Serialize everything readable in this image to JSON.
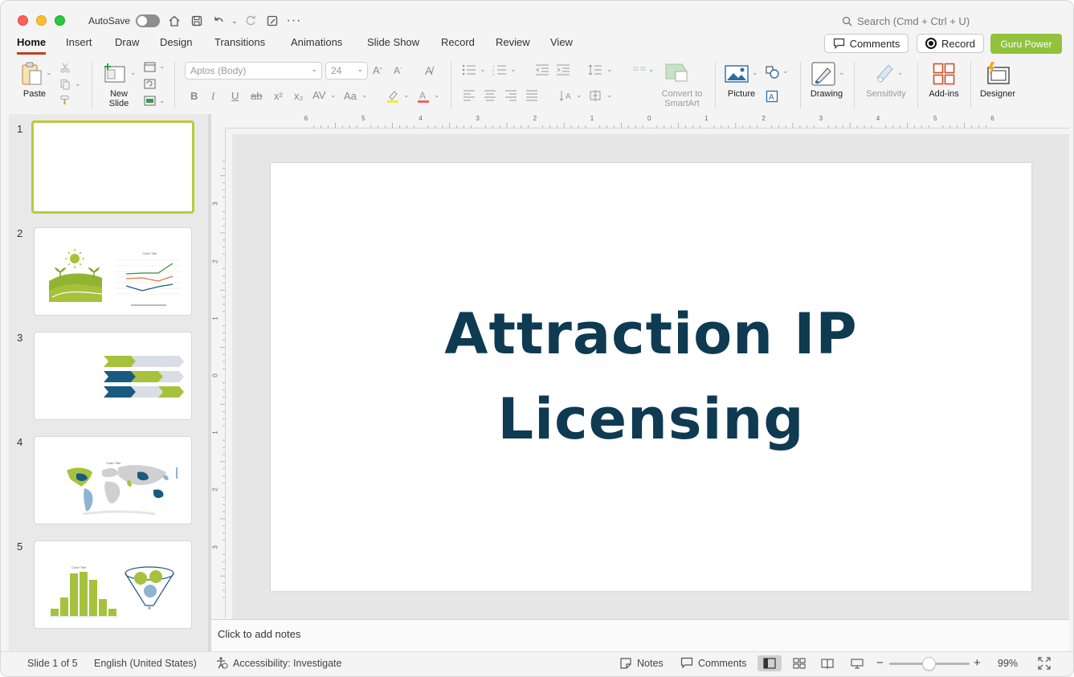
{
  "titlebar": {
    "autosave_label": "AutoSave",
    "search_placeholder": "Search (Cmd + Ctrl + U)"
  },
  "tabs": [
    {
      "label": "Home",
      "active": true
    },
    {
      "label": "Insert"
    },
    {
      "label": "Draw"
    },
    {
      "label": "Design"
    },
    {
      "label": "Transitions"
    },
    {
      "label": "Animations"
    },
    {
      "label": "Slide Show"
    },
    {
      "label": "Record"
    },
    {
      "label": "Review"
    },
    {
      "label": "View"
    }
  ],
  "header_buttons": {
    "comments": "Comments",
    "record": "Record",
    "guru": "Guru Power"
  },
  "ribbon": {
    "paste": "Paste",
    "new_slide_line1": "New",
    "new_slide_line2": "Slide",
    "font_name": "Aptos (Body)",
    "font_size": "24",
    "convert_line1": "Convert to",
    "convert_line2": "SmartArt",
    "picture": "Picture",
    "drawing": "Drawing",
    "sensitivity": "Sensitivity",
    "addins": "Add-ins",
    "designer": "Designer"
  },
  "slides": [
    {
      "number": "1"
    },
    {
      "number": "2",
      "chart_title": "Chart Title"
    },
    {
      "number": "3"
    },
    {
      "number": "4",
      "chart_title": "Chart Title"
    },
    {
      "number": "5",
      "chart_title": "Chart Title"
    }
  ],
  "ruler_h": [
    "6",
    "5",
    "4",
    "3",
    "2",
    "1",
    "0",
    "1",
    "2",
    "3",
    "4",
    "5",
    "6"
  ],
  "ruler_v": [
    "3",
    "2",
    "1",
    "0",
    "1",
    "2",
    "3"
  ],
  "slide": {
    "title_line1": "Attraction IP",
    "title_line2": "Licensing",
    "title_color": "#0e3a52"
  },
  "notes_placeholder": "Click to add notes",
  "status": {
    "slide_count": "Slide 1 of 5",
    "language": "English (United States)",
    "accessibility": "Accessibility: Investigate",
    "notes": "Notes",
    "comments": "Comments",
    "zoom": "99%"
  },
  "colors": {
    "accent_green": "#92c13c",
    "accent_blue": "#1a5a80",
    "active_tab_underline": "#c43e1c"
  }
}
